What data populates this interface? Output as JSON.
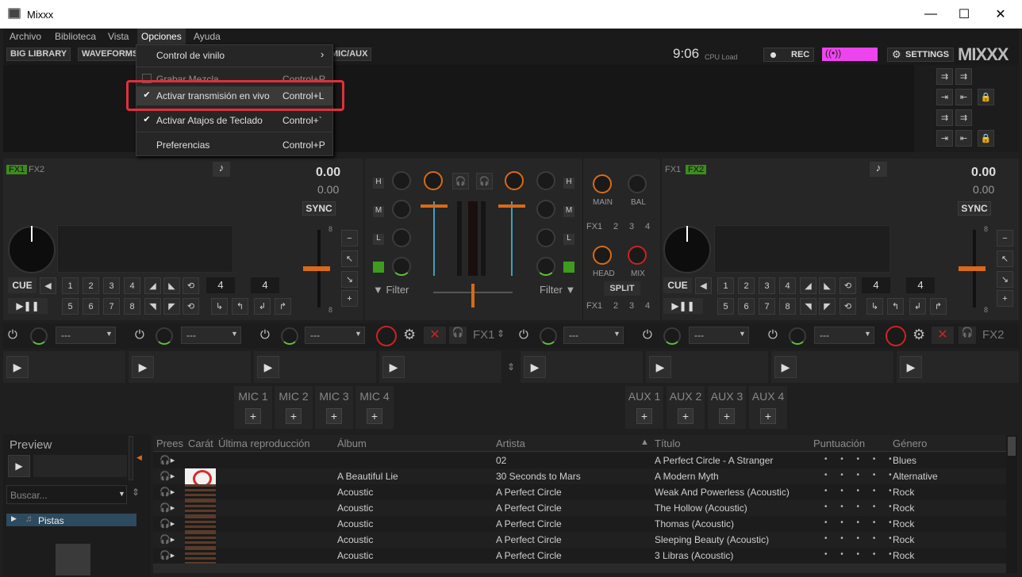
{
  "window": {
    "title": "Mixxx",
    "minimize": "—",
    "maximize": "☐",
    "close": "✕"
  },
  "menubar": {
    "items": [
      "Archivo",
      "Biblioteca",
      "Vista",
      "Opciones",
      "Ayuda"
    ]
  },
  "toolbar": {
    "big_library": "BIG LIBRARY",
    "waveforms": "WAVEFORMS",
    "mic_aux": "MIC/AUX",
    "time": "9:06",
    "cpu_load": "CPU Load",
    "rec": "REC",
    "settings": "SETTINGS",
    "logo": "MIXXX",
    "broadcast_color": "#ee44ee"
  },
  "options_menu": {
    "items": [
      {
        "label": "Control de vinilo",
        "shortcut": "",
        "checked": false,
        "submenu": true
      },
      {
        "label": "Grabar Mezcla",
        "shortcut": "Control+R",
        "checked": false
      },
      {
        "label": "Activar transmisión en vivo",
        "shortcut": "Control+L",
        "checked": true
      },
      {
        "label": "Activar Atajos de Teclado",
        "shortcut": "Control+`",
        "checked": true
      },
      {
        "label": "Preferencias",
        "shortcut": "Control+P",
        "checked": false
      }
    ]
  },
  "deck1": {
    "fx1": "FX1",
    "fx2": "FX2",
    "tempo": "0.00",
    "rate": "0.00",
    "sync": "SYNC",
    "cue": "CUE",
    "hotcues_top": [
      "1",
      "2",
      "3",
      "4"
    ],
    "hotcues_bottom": [
      "5",
      "6",
      "7",
      "8"
    ],
    "loop_size_1": "4",
    "loop_size_2": "4",
    "pitch_max": "8",
    "pitch_min": "8"
  },
  "deck2": {
    "fx1": "FX1",
    "fx2": "FX2",
    "tempo": "0.00",
    "rate": "0.00",
    "sync": "SYNC",
    "cue": "CUE",
    "hotcues_top": [
      "1",
      "2",
      "3",
      "4"
    ],
    "hotcues_bottom": [
      "5",
      "6",
      "7",
      "8"
    ],
    "loop_size_1": "4",
    "loop_size_2": "4",
    "pitch_max": "8",
    "pitch_min": "8"
  },
  "mixer": {
    "eq": [
      "H",
      "M",
      "L"
    ],
    "filter": "Filter",
    "main": "MAIN",
    "bal": "BAL",
    "head": "HEAD",
    "mix": "MIX",
    "split": "SPLIT",
    "fx_buttons": [
      "FX1",
      "2",
      "3",
      "4"
    ]
  },
  "fx_row": {
    "placeholder": "---",
    "unit1": "FX1",
    "unit2": "FX2"
  },
  "mics": [
    "MIC 1",
    "MIC 2",
    "MIC 3",
    "MIC 4"
  ],
  "auxes": [
    "AUX 1",
    "AUX 2",
    "AUX 3",
    "AUX 4"
  ],
  "library": {
    "preview": "Preview",
    "search_placeholder": "Buscar...",
    "tree_item": "Pistas",
    "columns": [
      "Prees",
      "Carát",
      "Última reproducción",
      "Álbum",
      "Artista",
      "Título",
      "Puntuación",
      "Género"
    ],
    "sort_indicator": "▲",
    "rows": [
      {
        "album": "",
        "artist": "02",
        "title": "A Perfect Circle - A Stranger",
        "genre": "Blues",
        "cover": "none"
      },
      {
        "album": "A Beautiful Lie",
        "artist": "30 Seconds to Mars",
        "title": "A Modern Myth",
        "genre": "Alternative",
        "cover": "white"
      },
      {
        "album": "Acoustic",
        "artist": "A Perfect Circle",
        "title": "Weak And Powerless (Acoustic)",
        "genre": "Rock",
        "cover": "dark"
      },
      {
        "album": "Acoustic",
        "artist": "A Perfect Circle",
        "title": "The Hollow (Acoustic)",
        "genre": "Rock",
        "cover": "dark"
      },
      {
        "album": "Acoustic",
        "artist": "A Perfect Circle",
        "title": "Thomas (Acoustic)",
        "genre": "Rock",
        "cover": "dark"
      },
      {
        "album": "Acoustic",
        "artist": "A Perfect Circle",
        "title": "Sleeping Beauty (Acoustic)",
        "genre": "Rock",
        "cover": "dark"
      },
      {
        "album": "Acoustic",
        "artist": "A Perfect Circle",
        "title": "3 Libras (Acoustic)",
        "genre": "Rock",
        "cover": "dark"
      }
    ],
    "rating_dots": "• • • • •"
  }
}
